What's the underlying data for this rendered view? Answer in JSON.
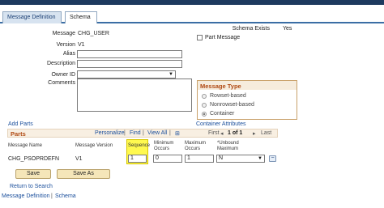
{
  "tabs": [
    {
      "label": "Message Definition",
      "active": true
    },
    {
      "label": "Schema",
      "active": false
    }
  ],
  "form": {
    "message_label": "Message",
    "message_value": "CHG_USER",
    "version_label": "Version",
    "version_value": "V1",
    "alias_label": "Alias",
    "alias_value": "",
    "description_label": "Description",
    "description_value": "",
    "owner_label": "Owner ID",
    "owner_value": "",
    "comments_label": "Comments",
    "comments_value": "",
    "schema_exists_label": "Schema Exists",
    "schema_exists_value": "Yes",
    "part_message_label": "Part Message",
    "part_message_checked": false
  },
  "message_type": {
    "title": "Message Type",
    "options": [
      {
        "label": "Rowset-based",
        "selected": false
      },
      {
        "label": "Nonrowset-based",
        "selected": false
      },
      {
        "label": "Container",
        "selected": true
      }
    ]
  },
  "links": {
    "add_parts": "Add Parts",
    "container_attributes": "Container Attributes",
    "return_to_search": "Return to Search",
    "footer_message_definition": "Message Definition",
    "footer_separator": "|",
    "footer_schema": "Schema"
  },
  "parts": {
    "title": "Parts",
    "personalize": "Personalize",
    "find": "Find",
    "view_all": "View All",
    "first": "First",
    "pager": "1 of 1",
    "last": "Last",
    "columns": [
      "Message Name",
      "Message Version",
      "Sequence",
      "Minimum Occurs",
      "Maximum Occurs",
      "*Unbound Maximum"
    ],
    "rows": [
      {
        "message_name": "CHG_PSOPRDEFN",
        "message_version": "V1",
        "sequence": "1",
        "minimum_occurs": "0",
        "maximum_occurs": "1",
        "unbound_maximum": "N"
      }
    ]
  },
  "buttons": {
    "save": "Save",
    "save_as": "Save As"
  },
  "colors": {
    "header_bar": "#1d3a5f",
    "group_heading": "#b04a14",
    "link": "#1b4f9c",
    "highlight": "#fff94f"
  }
}
